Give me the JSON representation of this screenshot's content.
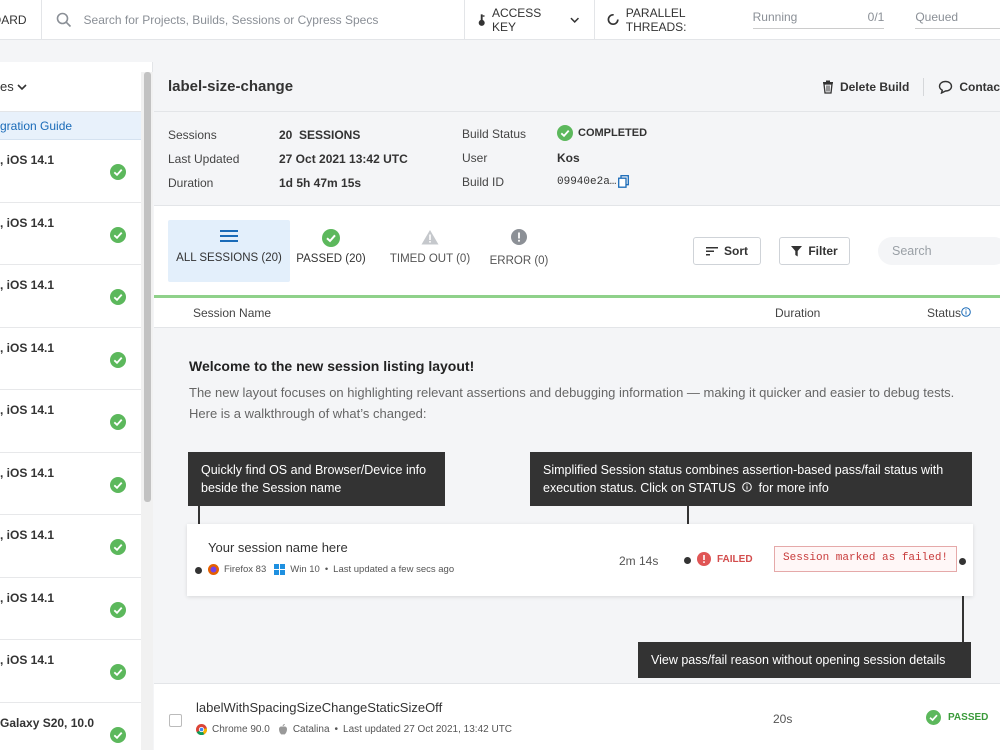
{
  "topbar": {
    "dashboard_label": "OARD",
    "search_placeholder": "Search for Projects, Builds, Sessions or Cypress Specs",
    "access_key_label": "ACCESS KEY",
    "parallel_threads_label": "PARALLEL THREADS:",
    "running_label": "Running",
    "running_value": "0/1",
    "queued_label": "Queued"
  },
  "sidebar": {
    "header_label": "es",
    "guide_label": "gration Guide",
    "items": [
      {
        "label": ", iOS 14.1"
      },
      {
        "label": ", iOS 14.1"
      },
      {
        "label": ", iOS 14.1"
      },
      {
        "label": ", iOS 14.1"
      },
      {
        "label": ", iOS 14.1"
      },
      {
        "label": ", iOS 14.1"
      },
      {
        "label": ", iOS 14.1"
      },
      {
        "label": ", iOS 14.1"
      },
      {
        "label": ", iOS 14.1"
      },
      {
        "label": "Galaxy S20, 10.0"
      }
    ]
  },
  "build": {
    "title": "label-size-change",
    "delete_label": "Delete Build",
    "contact_label": "Contac",
    "sessions_key": "Sessions",
    "sessions_count": "20",
    "sessions_unit": "SESSIONS",
    "last_updated_key": "Last Updated",
    "last_updated_value": "27 Oct 2021 13:42 UTC",
    "duration_key": "Duration",
    "duration_value": "1d 5h 47m 15s",
    "status_key": "Build Status",
    "status_value": "COMPLETED",
    "user_key": "User",
    "user_value": "Kos",
    "build_id_key": "Build ID",
    "build_id_value": "09940e2a…"
  },
  "tabs": [
    {
      "label": "ALL SESSIONS (20)",
      "icon": "list-icon"
    },
    {
      "label": "PASSED (20)",
      "icon": "check-circle-icon"
    },
    {
      "label": "TIMED OUT (0)",
      "icon": "warning-icon"
    },
    {
      "label": "ERROR (0)",
      "icon": "error-icon"
    }
  ],
  "toolbar": {
    "sort_label": "Sort",
    "filter_label": "Filter",
    "search_placeholder": "Search"
  },
  "columns": {
    "session_name": "Session Name",
    "duration": "Duration",
    "status": "Status"
  },
  "welcome": {
    "title": "Welcome to the new session listing layout!",
    "line1": "The new layout focuses on highlighting relevant assertions and debugging information — making it quicker and easier to debug tests.",
    "line2": "Here is a walkthrough of what’s changed:",
    "callout_os": "Quickly find OS and Browser/Device info beside the Session name",
    "callout_status_a": "Simplified Session status combines assertion-based pass/fail status with execution status. Click on STATUS",
    "callout_status_b": "for more info",
    "callout_reason": "View pass/fail reason without opening session details",
    "sample": {
      "name": "Your session name here",
      "browser": "Firefox 83",
      "os": "Win 10",
      "updated": "Last updated a few secs ago",
      "duration": "2m 14s",
      "status": "FAILED",
      "reason": "Session marked as failed!"
    }
  },
  "rows": [
    {
      "name": "labelWithSpacingSizeChangeStaticSizeOff",
      "browser": "Chrome 90.0",
      "os": "Catalina",
      "updated": "Last updated 27 Oct 2021, 13:42 UTC",
      "duration": "20s",
      "status": "PASSED"
    }
  ],
  "colors": {
    "accent_blue": "#1a6bb8",
    "success_green": "#5cb85c",
    "fail_red": "#e05555",
    "tab_underline": "#8fd18a"
  }
}
